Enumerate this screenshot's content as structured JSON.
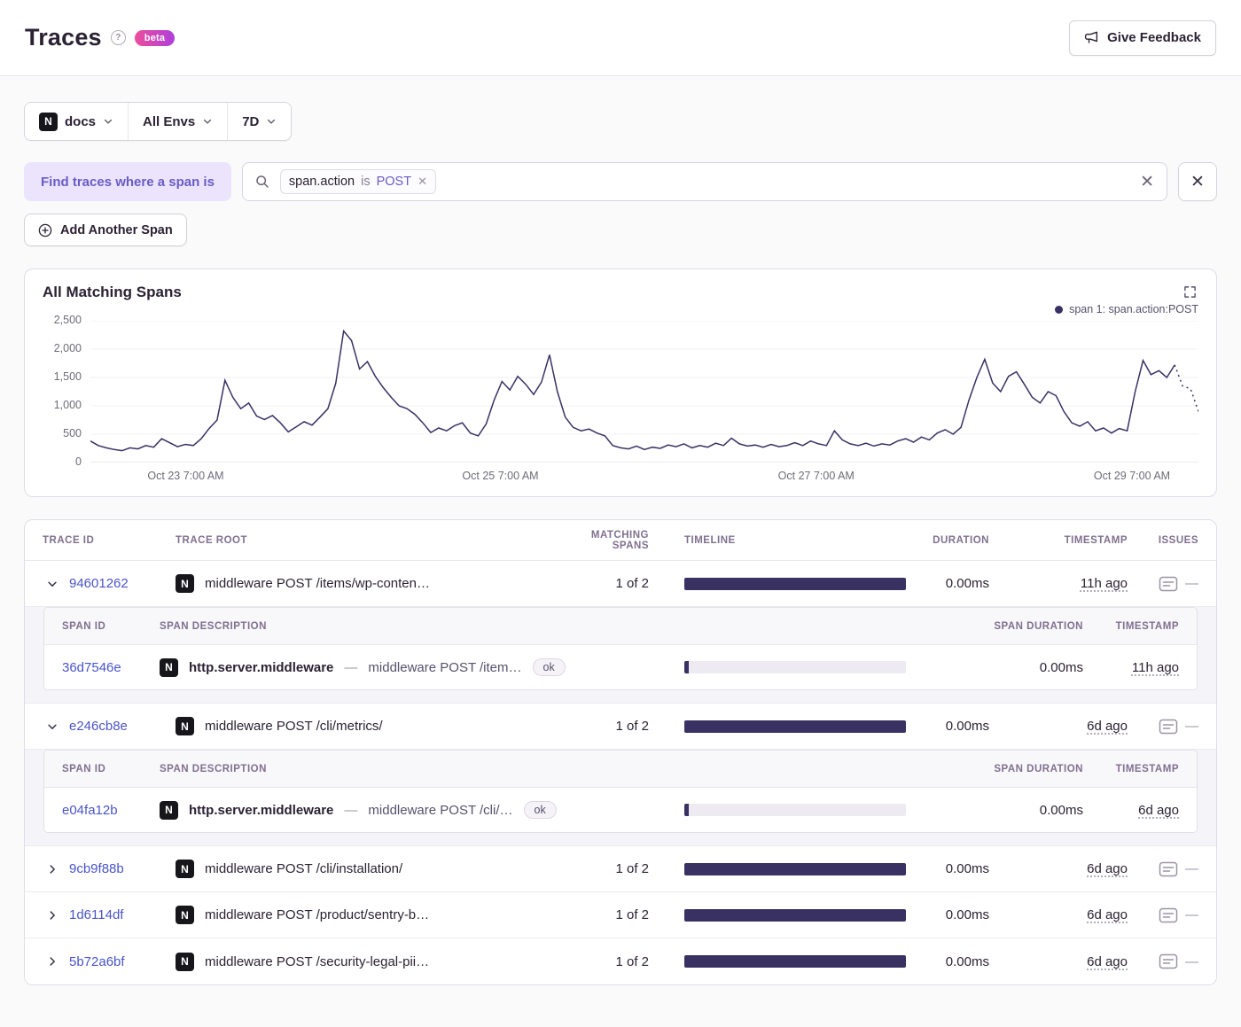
{
  "colors": {
    "accent": "#6a5cc5",
    "line": "#3a3163",
    "link": "#4a55c7",
    "bar": "#3a3163"
  },
  "platform_letter": "N",
  "header": {
    "title": "Traces",
    "beta_label": "beta",
    "feedback_label": "Give Feedback"
  },
  "filters": {
    "project": "docs",
    "environment": "All Envs",
    "period": "7D"
  },
  "search": {
    "find_label": "Find traces where a span is",
    "token_key": "span.action",
    "token_op": "is",
    "token_value": "POST",
    "add_span_label": "Add Another Span"
  },
  "chart_data": {
    "type": "line",
    "title": "All Matching Spans",
    "legend": [
      "span 1: span.action:POST"
    ],
    "legend_position": "top-right",
    "grid": true,
    "ylim": [
      0,
      2500
    ],
    "y_ticks": [
      0,
      500,
      1000,
      1500,
      2000,
      2500
    ],
    "y_tick_labels": [
      "0",
      "500",
      "1,000",
      "1,500",
      "2,000",
      "2,500"
    ],
    "x_ticks": [
      "Oct 23 7:00 AM",
      "Oct 25 7:00 AM",
      "Oct 27 7:00 AM",
      "Oct 29 7:00 AM"
    ],
    "x_tick_pos": [
      8.6,
      37,
      65.5,
      94
    ],
    "dashed_from": 137,
    "series": [
      {
        "name": "span 1: span.action:POST",
        "values": [
          380,
          300,
          260,
          230,
          210,
          260,
          240,
          300,
          270,
          420,
          350,
          280,
          320,
          300,
          420,
          600,
          750,
          1450,
          1150,
          950,
          1050,
          820,
          760,
          830,
          700,
          540,
          630,
          720,
          660,
          800,
          950,
          1400,
          2320,
          2150,
          1650,
          1780,
          1520,
          1320,
          1150,
          1000,
          950,
          850,
          700,
          530,
          610,
          560,
          650,
          700,
          520,
          470,
          680,
          1100,
          1430,
          1280,
          1520,
          1380,
          1200,
          1420,
          1900,
          1250,
          800,
          620,
          560,
          590,
          520,
          470,
          300,
          260,
          240,
          290,
          230,
          270,
          250,
          310,
          280,
          330,
          260,
          300,
          270,
          340,
          300,
          430,
          330,
          290,
          310,
          270,
          320,
          280,
          300,
          350,
          300,
          380,
          330,
          300,
          560,
          400,
          330,
          300,
          340,
          290,
          330,
          310,
          380,
          420,
          360,
          450,
          400,
          520,
          580,
          500,
          620,
          1100,
          1500,
          1820,
          1400,
          1250,
          1520,
          1600,
          1380,
          1150,
          1050,
          1250,
          1180,
          900,
          700,
          640,
          720,
          560,
          610,
          520,
          600,
          560,
          1250,
          1800,
          1550,
          1620,
          1500,
          1720,
          1350,
          1300,
          900
        ]
      }
    ]
  },
  "table": {
    "columns": {
      "trace_id": "Trace ID",
      "trace_root": "Trace Root",
      "matching_spans": "Matching Spans",
      "timeline": "Timeline",
      "duration": "Duration",
      "timestamp": "Timestamp",
      "issues": "Issues"
    },
    "sub_columns": {
      "span_id": "Span ID",
      "span_description": "Span Description",
      "span_duration": "Span Duration",
      "timestamp": "Timestamp"
    },
    "empty_issues": "—",
    "span_separator": "—",
    "rows": [
      {
        "id": "94601262",
        "root": "middleware POST /items/wp-conten…",
        "matching": "1 of 2",
        "duration": "0.00ms",
        "timestamp": "11h ago",
        "spans": [
          {
            "id": "36d7546e",
            "op": "http.server.middleware",
            "description": "middleware POST /item…",
            "status": "ok",
            "duration": "0.00ms",
            "timestamp": "11h ago"
          }
        ]
      },
      {
        "id": "e246cb8e",
        "root": "middleware POST /cli/metrics/",
        "matching": "1 of 2",
        "duration": "0.00ms",
        "timestamp": "6d ago",
        "spans": [
          {
            "id": "e04fa12b",
            "op": "http.server.middleware",
            "description": "middleware POST /cli/…",
            "status": "ok",
            "duration": "0.00ms",
            "timestamp": "6d ago"
          }
        ]
      },
      {
        "id": "9cb9f88b",
        "root": "middleware POST /cli/installation/",
        "matching": "1 of 2",
        "duration": "0.00ms",
        "timestamp": "6d ago"
      },
      {
        "id": "1d6114df",
        "root": "middleware POST /product/sentry-b…",
        "matching": "1 of 2",
        "duration": "0.00ms",
        "timestamp": "6d ago"
      },
      {
        "id": "5b72a6bf",
        "root": "middleware POST /security-legal-pii…",
        "matching": "1 of 2",
        "duration": "0.00ms",
        "timestamp": "6d ago"
      }
    ]
  }
}
